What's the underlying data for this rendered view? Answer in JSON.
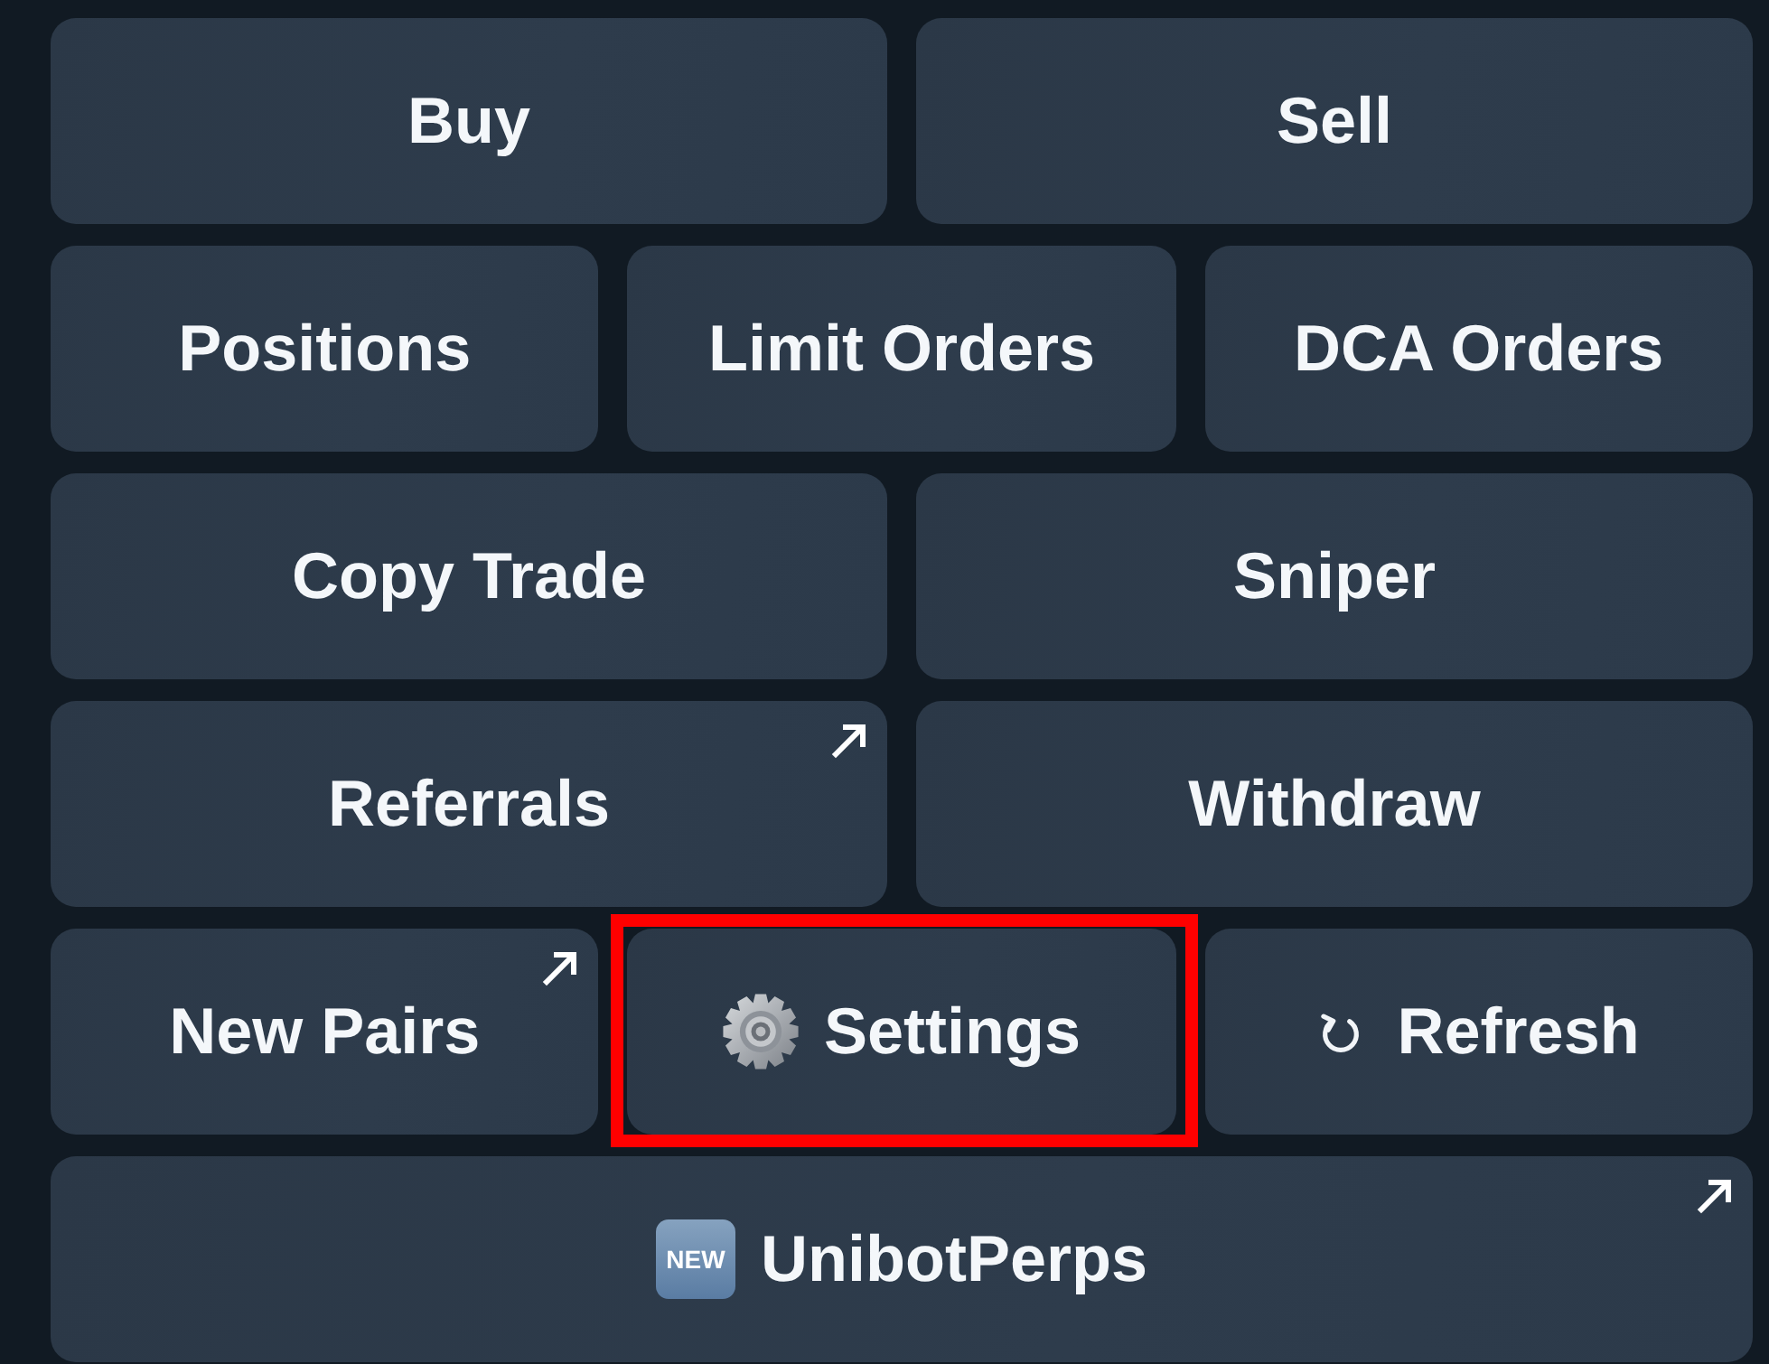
{
  "keyboard": {
    "rows": [
      {
        "buttons": [
          {
            "label": "Buy",
            "kind": "text",
            "external": false,
            "highlighted": false
          },
          {
            "label": "Sell",
            "kind": "text",
            "external": false,
            "highlighted": false
          }
        ]
      },
      {
        "buttons": [
          {
            "label": "Positions",
            "kind": "text",
            "external": false,
            "highlighted": false
          },
          {
            "label": "Limit Orders",
            "kind": "text",
            "external": false,
            "highlighted": false
          },
          {
            "label": "DCA Orders",
            "kind": "text",
            "external": false,
            "highlighted": false
          }
        ]
      },
      {
        "buttons": [
          {
            "label": "Copy Trade",
            "kind": "text",
            "external": false,
            "highlighted": false
          },
          {
            "label": "Sniper",
            "kind": "text",
            "external": false,
            "highlighted": false
          }
        ]
      },
      {
        "buttons": [
          {
            "label": "Referrals",
            "kind": "text",
            "external": true,
            "highlighted": false
          },
          {
            "label": "Withdraw",
            "kind": "text",
            "external": false,
            "highlighted": false
          }
        ]
      },
      {
        "buttons": [
          {
            "label": "New Pairs",
            "kind": "text",
            "external": true,
            "highlighted": false
          },
          {
            "label": "Settings",
            "kind": "gear",
            "external": false,
            "highlighted": true
          },
          {
            "label": "Refresh",
            "kind": "refresh",
            "external": false,
            "highlighted": false
          }
        ]
      },
      {
        "buttons": [
          {
            "label": "UnibotPerps",
            "kind": "badge",
            "badge": "NEW",
            "external": true,
            "highlighted": false
          }
        ]
      }
    ]
  }
}
